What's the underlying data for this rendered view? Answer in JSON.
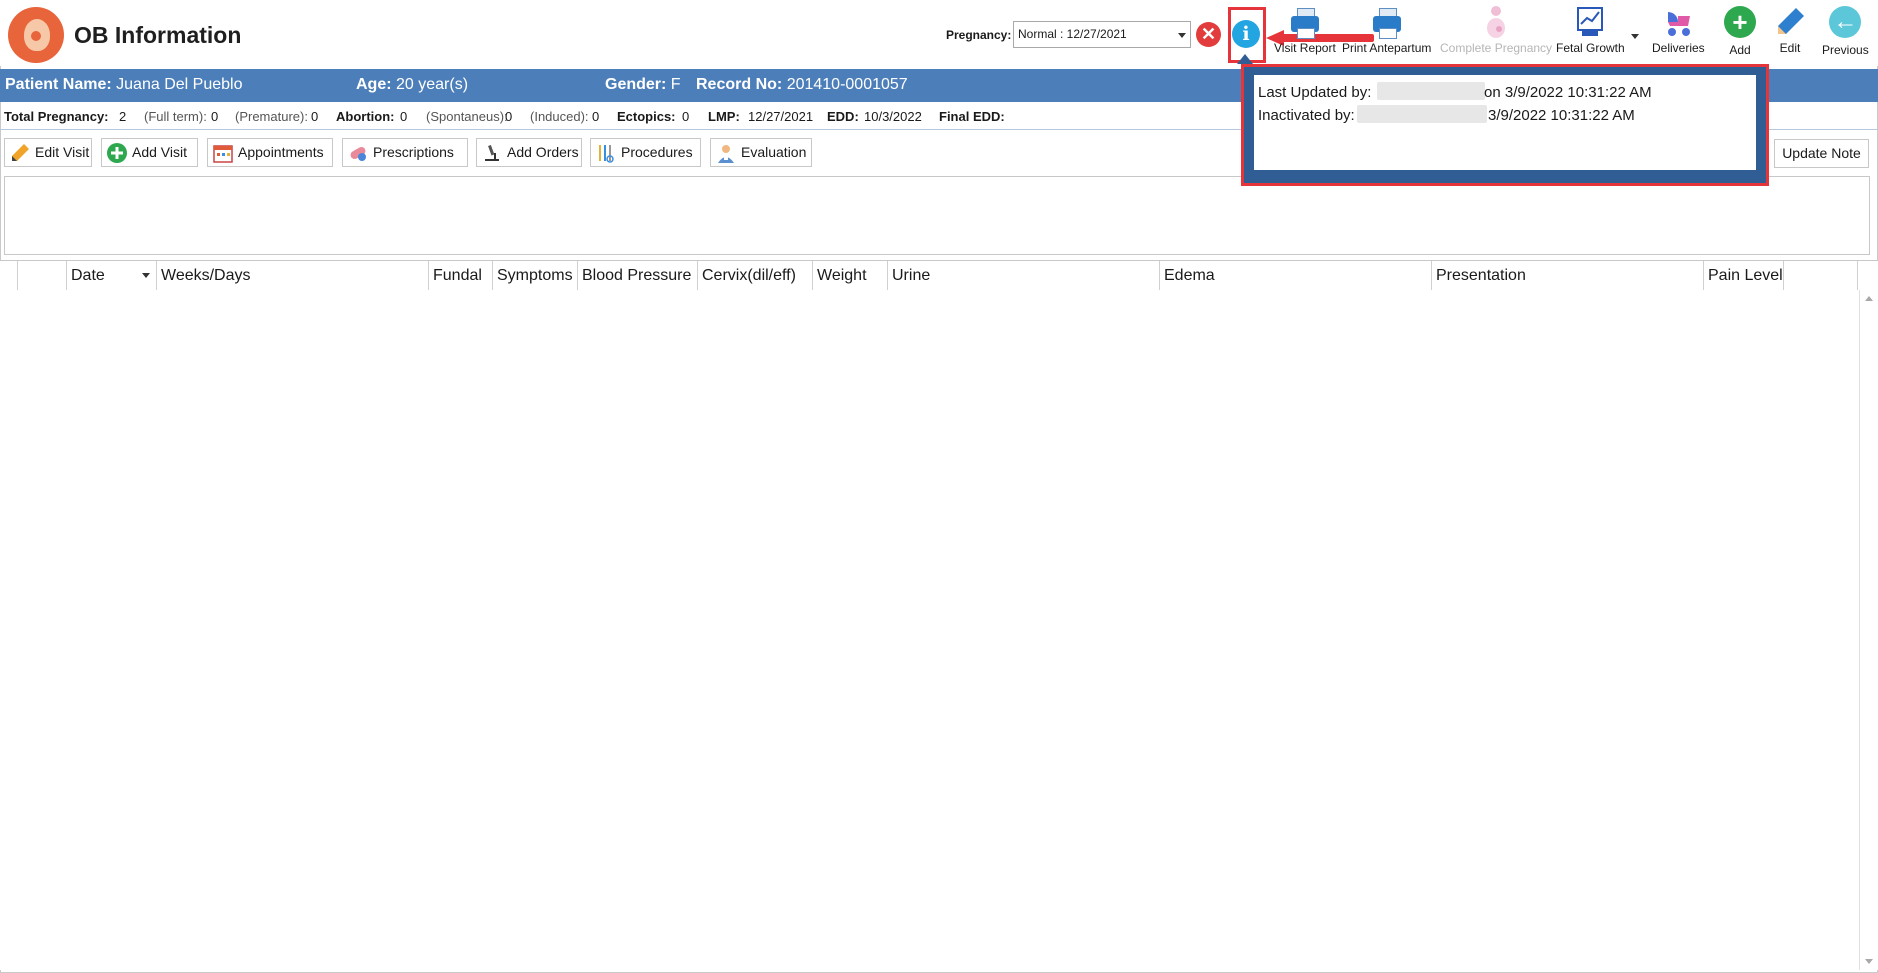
{
  "header": {
    "title": "OB Information",
    "pregnancy_label": "Pregnancy:",
    "pregnancy_value": "Normal : 12/27/2021"
  },
  "toolbar": [
    {
      "label": "Visit Report",
      "icon": "printer-icon",
      "enabled": true
    },
    {
      "label": "Print Antepartum",
      "icon": "printer-icon",
      "enabled": true
    },
    {
      "label": "Complete Pregnancy",
      "icon": "pregnant-woman-icon",
      "enabled": false
    },
    {
      "label": "Fetal Growth",
      "icon": "chart-icon",
      "enabled": true
    },
    {
      "label": "Deliveries",
      "icon": "stroller-icon",
      "enabled": true
    },
    {
      "label": "Add",
      "icon": "plus-circle-icon",
      "enabled": true
    },
    {
      "label": "Edit",
      "icon": "pencil-icon",
      "enabled": true
    },
    {
      "label": "Previous",
      "icon": "arrow-left-circle-icon",
      "enabled": true
    }
  ],
  "patient": {
    "name_label": "Patient Name:",
    "name": "Juana Del Pueblo",
    "age_label": "Age:",
    "age": "20 year(s)",
    "gender_label": "Gender:",
    "gender": "F",
    "record_label": "Record No:",
    "record": "201410-0001057"
  },
  "stats": {
    "total_pregnancy_label": "Total Pregnancy:",
    "total_pregnancy": "2",
    "full_term_label": "(Full term):",
    "full_term": "0",
    "premature_label": "(Premature):",
    "premature": "0",
    "abortion_label": "Abortion:",
    "abortion": "0",
    "spontaneus_label": "(Spontaneus):",
    "spontaneus": "0",
    "induced_label": "(Induced):",
    "induced": "0",
    "ectopics_label": "Ectopics:",
    "ectopics": "0",
    "lmp_label": "LMP:",
    "lmp": "12/27/2021",
    "edd_label": "EDD:",
    "edd": "10/3/2022",
    "final_edd_label": "Final EDD:",
    "final_edd": ""
  },
  "actions": {
    "edit_visit": "Edit Visit",
    "add_visit": "Add Visit",
    "appointments": "Appointments",
    "prescriptions": "Prescriptions",
    "add_orders": "Add Orders",
    "procedures": "Procedures",
    "evaluation": "Evaluation",
    "update_note": "Update Note"
  },
  "grid": {
    "columns": [
      "Date",
      "Weeks/Days",
      "Fundal",
      "Symptoms",
      "Blood Pressure",
      "Cervix(dil/eff)",
      "Weight",
      "Urine",
      "Edema",
      "Presentation",
      "Pain Level"
    ],
    "rows": []
  },
  "popup": {
    "last_updated_label": "Last Updated by:",
    "last_updated_suffix": "on 3/9/2022 10:31:22 AM",
    "inactivated_label": "Inactivated by:",
    "inactivated_suffix": "3/9/2022 10:31:22 AM"
  },
  "colors": {
    "patient_bar": "#4c7fb9",
    "highlight": "#e5353a",
    "popup_border": "#2f5d94",
    "info_icon": "#22a5e0"
  }
}
